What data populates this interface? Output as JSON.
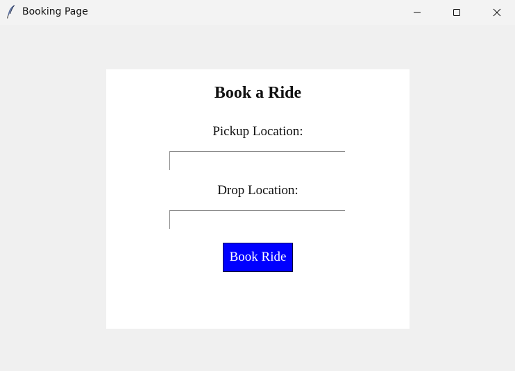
{
  "window": {
    "title": "Booking Page",
    "icon": "feather-icon",
    "controls": {
      "minimize": "minimize-icon",
      "maximize": "maximize-icon",
      "close": "close-icon"
    }
  },
  "form": {
    "heading": "Book a Ride",
    "pickup": {
      "label": "Pickup Location:",
      "value": "",
      "placeholder": ""
    },
    "drop": {
      "label": "Drop Location:",
      "value": "",
      "placeholder": ""
    },
    "submit_label": "Book Ride"
  },
  "colors": {
    "window_background": "#f0f0f0",
    "panel_background": "#ffffff",
    "button_background": "#0000ff",
    "button_text": "#ffffff"
  }
}
